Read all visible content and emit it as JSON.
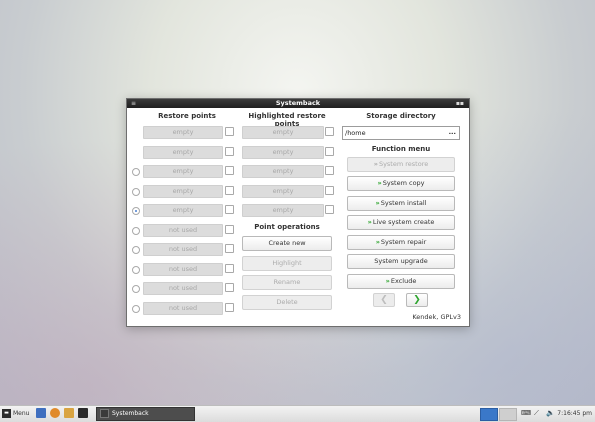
{
  "window": {
    "title": "Systemback",
    "headers": {
      "restore_points": "Restore points",
      "highlighted_restore_points": "Highlighted restore points",
      "storage_directory": "Storage directory",
      "function_menu": "Function menu",
      "point_operations": "Point operations"
    },
    "restore_points": [
      {
        "label": "empty"
      },
      {
        "label": "empty"
      },
      {
        "label": "empty"
      },
      {
        "label": "empty"
      },
      {
        "label": "empty"
      },
      {
        "label": "not used"
      },
      {
        "label": "not used"
      },
      {
        "label": "not used"
      },
      {
        "label": "not used"
      },
      {
        "label": "not used"
      }
    ],
    "highlighted_points": [
      {
        "label": "empty"
      },
      {
        "label": "empty"
      },
      {
        "label": "empty"
      },
      {
        "label": "empty"
      },
      {
        "label": "empty"
      }
    ],
    "selected_restore_point_index": 4,
    "point_operations": {
      "create_new": "Create new",
      "highlight": "Highlight",
      "rename": "Rename",
      "delete": "Delete"
    },
    "storage": {
      "path": "/home",
      "browse": "..."
    },
    "function_menu": {
      "system_restore": "System restore",
      "system_copy": "System copy",
      "system_install": "System install",
      "live_system_create": "Live system create",
      "system_repair": "System repair",
      "system_upgrade": "System upgrade",
      "exclude": "Exclude"
    },
    "nav": {
      "prev_icon": "arrow-left-icon",
      "next_icon": "arrow-right-icon"
    },
    "footer": "Kendek, GPLv3"
  },
  "taskbar": {
    "menu_label": "Menu",
    "task_label": "Systemback",
    "clock": "7:16:45 pm"
  },
  "colors": {
    "accent_green": "#2fa52f",
    "titlebar": "#2a2a2a",
    "disabled_field": "#dcdcdc"
  }
}
